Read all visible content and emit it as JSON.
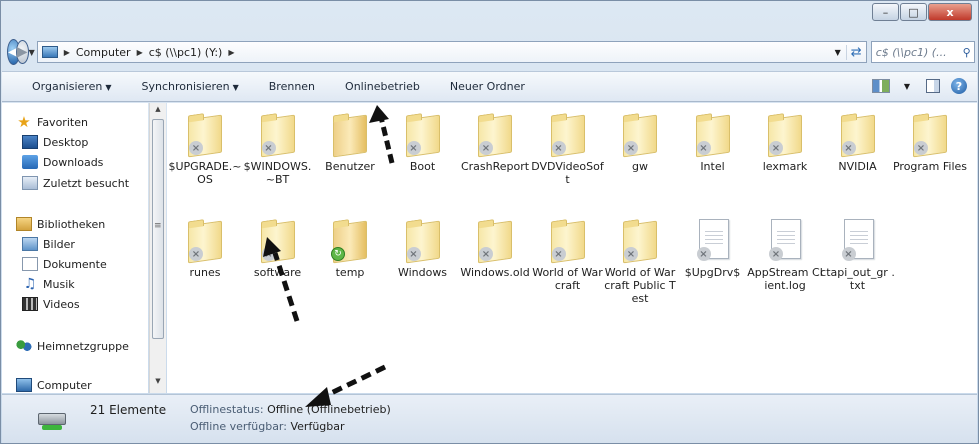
{
  "window": {
    "title": "",
    "controls": {
      "minimize": "–",
      "maximize": "□",
      "close": "x"
    }
  },
  "address_bar": {
    "crumbs": [
      "Computer",
      "c$ (\\\\pc1) (Y:)"
    ],
    "search_placeholder": "c$ (\\\\pc1) (..."
  },
  "toolbar": {
    "organize_label": "Organisieren",
    "sync_label": "Synchronisieren",
    "burn_label": "Brennen",
    "online_label": "Onlinebetrieb",
    "new_folder_label": "Neuer Ordner"
  },
  "nav_pane": {
    "favorites_label": "Favoriten",
    "desktop_label": "Desktop",
    "downloads_label": "Downloads",
    "recent_label": "Zuletzt besucht",
    "libraries_label": "Bibliotheken",
    "pictures_label": "Bilder",
    "documents_label": "Dokumente",
    "music_label": "Musik",
    "videos_label": "Videos",
    "homegroup_label": "Heimnetzgruppe",
    "computer_label": "Computer"
  },
  "items": [
    {
      "name": "$UPGRADE.~OS",
      "kind": "folder"
    },
    {
      "name": "$WINDOWS.~BT",
      "kind": "folder"
    },
    {
      "name": "Benutzer",
      "kind": "folder"
    },
    {
      "name": "Boot",
      "kind": "folder"
    },
    {
      "name": "CrashReport",
      "kind": "folder"
    },
    {
      "name": "DVDVideoSoft",
      "kind": "folder"
    },
    {
      "name": "gw",
      "kind": "folder"
    },
    {
      "name": "Intel",
      "kind": "folder"
    },
    {
      "name": "lexmark",
      "kind": "folder"
    },
    {
      "name": "NVIDIA",
      "kind": "folder"
    },
    {
      "name": "Program Files",
      "kind": "folder"
    },
    {
      "name": "runes",
      "kind": "folder"
    },
    {
      "name": "software",
      "kind": "folder"
    },
    {
      "name": "temp",
      "kind": "folder"
    },
    {
      "name": "Windows",
      "kind": "folder"
    },
    {
      "name": "Windows.old",
      "kind": "folder"
    },
    {
      "name": "World of Warcraft",
      "kind": "folder"
    },
    {
      "name": "World of Warcraft Public Test",
      "kind": "folder"
    },
    {
      "name": "$UpgDrv$",
      "kind": "file"
    },
    {
      "name": "AppStream Client.log",
      "kind": "file"
    },
    {
      "name": "ctapi_out_gr .txt",
      "kind": "file"
    }
  ],
  "status_bar": {
    "count": "21 Elemente",
    "offline_status_label": "Offlinestatus:",
    "offline_status_value": "Offline (Offlinebetrieb)",
    "offline_available_label": "Offline verfügbar:",
    "offline_available_value": "Verfügbar"
  }
}
